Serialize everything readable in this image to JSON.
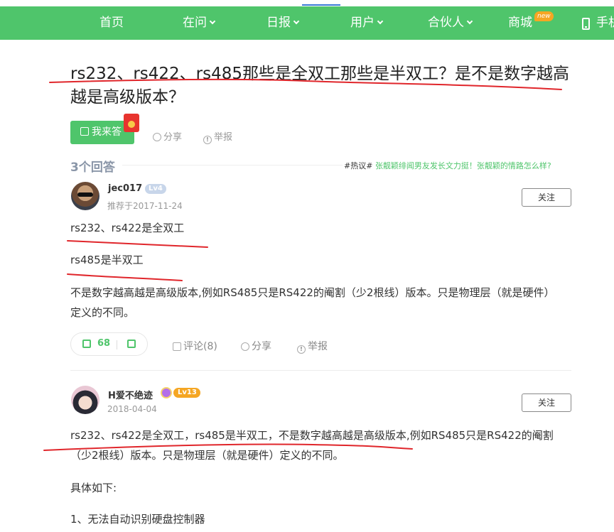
{
  "nav": {
    "items": [
      "首页",
      "在问",
      "日报",
      "用户",
      "合伙人",
      "商城",
      "手机"
    ],
    "new_badge": "new"
  },
  "question": {
    "title": "rs232、rs422、rs485那些是全双工那些是半双工？是不是数字越高越是高级版本？",
    "answer_button": "我来答",
    "share": "分享",
    "report": "举报"
  },
  "answers_header": {
    "count": "3个回答",
    "hot_tag": "#热议#",
    "hot_text": "张靓颖绯闻男友发长文力挺！张靓颖的情路怎么样?"
  },
  "answer1": {
    "user": "jec017",
    "level": "Lv4",
    "date": "推荐于2017-11-24",
    "follow": "关注",
    "lines": [
      "rs232、rs422是全双工",
      "rs485是半双工",
      "不是数字越高越是高级版本,例如RS485只是RS422的阉割（少2根线）版本。只是物理层（就是硬件）定义的不同。"
    ],
    "likes": "68",
    "comment": "评论(8)",
    "share": "分享",
    "report": "举报"
  },
  "answer2": {
    "user": "H爱不绝迹",
    "level": "Lv13",
    "date": "2018-04-04",
    "follow": "关注",
    "lines": [
      "rs232、rs422是全双工，rs485是半双工，不是数字越高越是高级版本,例如RS485只是RS422的阉割（少2根线）版本。只是物理层（就是硬件）定义的不同。",
      "具体如下:",
      "1、无法自动识别硬盘控制器"
    ]
  },
  "colors": {
    "brand_green": "#4fc56b",
    "annotation_red": "#e0262b"
  }
}
